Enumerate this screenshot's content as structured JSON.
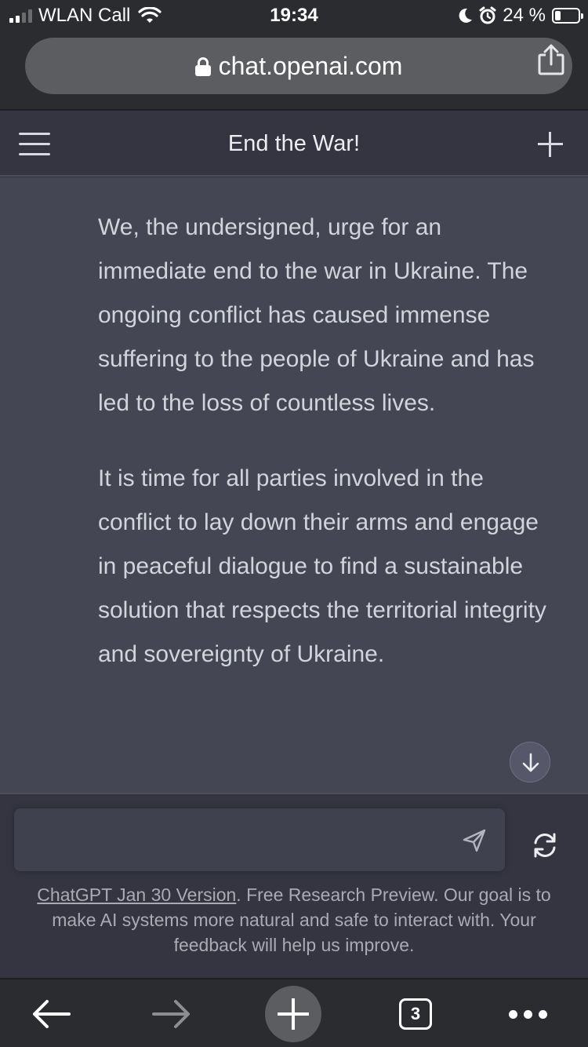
{
  "status_bar": {
    "carrier": "WLAN Call",
    "time": "19:34",
    "battery_percent": "24 %",
    "battery_level": 0.24,
    "icons": [
      "signal-icon",
      "wifi-icon",
      "moon-icon",
      "alarm-icon",
      "battery-icon"
    ]
  },
  "browser": {
    "url": "chat.openai.com",
    "icons": [
      "lock-icon",
      "share-icon"
    ]
  },
  "chat": {
    "title": "End the War!",
    "paragraphs": [
      "We, the undersigned, urge for an immediate end to the war in Ukraine. The ongoing conflict has caused immense suffering to the people of Ukraine and has led to the loss of countless lives.",
      "It is time for all parties involved in the conflict to lay down their arms and engage in peaceful dialogue to find a sustainable solution that respects the territorial integrity and sovereignty of Ukraine."
    ]
  },
  "composer": {
    "placeholder": "",
    "version_link": "ChatGPT Jan 30 Version",
    "disclaimer_rest": ". Free Research Preview. Our goal is to make AI systems more natural and safe to interact with. Your feedback will help us improve."
  },
  "toolbar": {
    "tab_count": "3"
  },
  "colors": {
    "background": "#343541",
    "message_background": "#444654",
    "text": "#d1d5db",
    "browser_chrome": "#2b2c2f"
  }
}
